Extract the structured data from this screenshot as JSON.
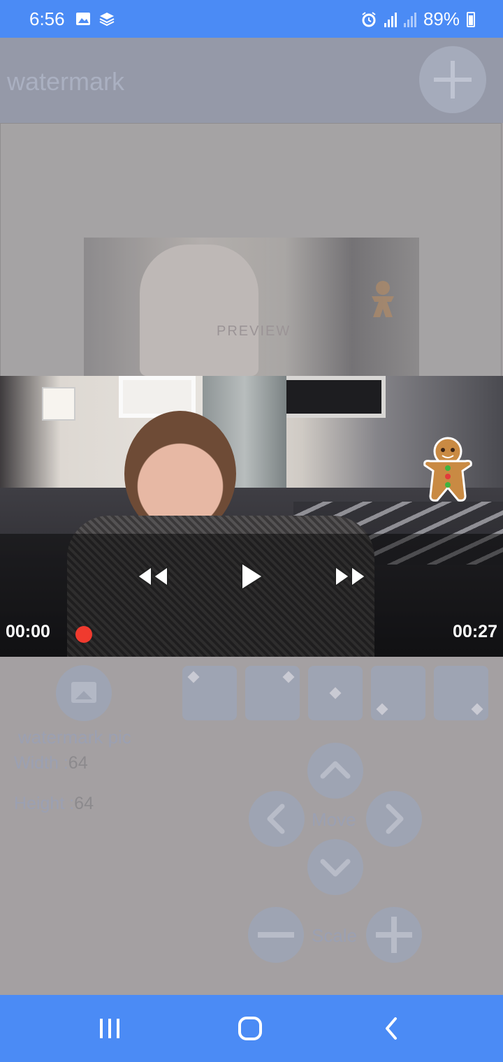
{
  "status_bar": {
    "time": "6:56",
    "battery_percent": "89%"
  },
  "app_bar": {
    "title": "watermark"
  },
  "preview": {
    "label": "PREVIEW"
  },
  "video": {
    "current_time": "00:00",
    "total_time": "00:27"
  },
  "controls": {
    "watermark_pic_label": "watermark pic",
    "width_label": "Width :",
    "width_value": "64",
    "height_label": "Height :",
    "height_value": "64",
    "move_label": "Move",
    "scale_label": "Scale"
  },
  "colors": {
    "accent": "#4b8bf5",
    "seek_thumb": "#f03a2e"
  }
}
